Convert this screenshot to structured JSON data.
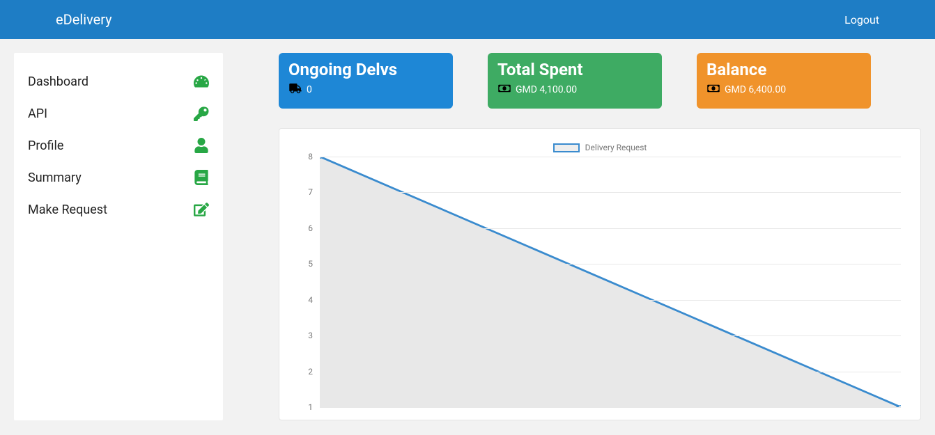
{
  "header": {
    "brand": "eDelivery",
    "logout": "Logout"
  },
  "sidebar": {
    "items": [
      {
        "label": "Dashboard",
        "icon": "dashboard-icon"
      },
      {
        "label": "API",
        "icon": "key-icon"
      },
      {
        "label": "Profile",
        "icon": "user-icon"
      },
      {
        "label": "Summary",
        "icon": "book-icon"
      },
      {
        "label": "Make Request",
        "icon": "edit-icon"
      }
    ]
  },
  "cards": {
    "ongoing": {
      "title": "Ongoing Delvs",
      "value": "0"
    },
    "spent": {
      "title": "Total Spent",
      "value": "GMD 4,100.00"
    },
    "balance": {
      "title": "Balance",
      "value": "GMD 6,400.00"
    }
  },
  "chart_data": {
    "type": "line",
    "legend": "Delivery Request",
    "x": [
      0,
      1
    ],
    "values": [
      8,
      1
    ],
    "ylim": [
      1,
      8
    ],
    "yticks": [
      1,
      2,
      3,
      4,
      5,
      6,
      7,
      8
    ],
    "fill": "#e8e8e8",
    "stroke": "#3a8bce"
  }
}
